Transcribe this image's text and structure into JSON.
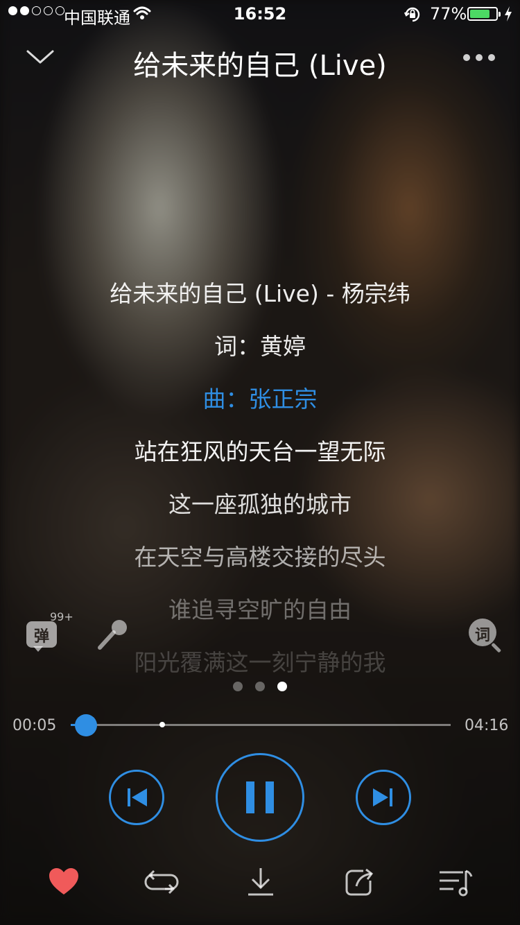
{
  "status_bar": {
    "carrier": "中国联通",
    "time": "16:52",
    "battery_percent": "77%",
    "battery_level": 0.77,
    "signal_bars": 2,
    "signal_total": 5
  },
  "header": {
    "title": "给未来的自己 (Live)",
    "collapse_icon": "chevron-down-icon",
    "more_icon": "more-dots-icon"
  },
  "lyrics": {
    "lines": [
      "给未来的自己 (Live) - 杨宗纬",
      "词：黄婷",
      "曲：张正宗",
      "站在狂风的天台一望无际",
      "这一座孤独的城市",
      "在天空与高楼交接的尽头",
      "谁追寻空旷的自由",
      "阳光覆满这一刻宁静的我"
    ],
    "active_index": 2
  },
  "side_actions": {
    "danmu_label": "弹",
    "danmu_count": "99+",
    "lyrics_search_label": "词"
  },
  "pager": {
    "pages": 3,
    "current": 2
  },
  "progress": {
    "current_time": "00:05",
    "total_time": "04:16",
    "played_fraction": 0.04,
    "buffered_fraction": 0.24
  },
  "colors": {
    "accent": "#2f8ee3",
    "favorite": "#f05a5a"
  },
  "controls": {
    "prev_icon": "skip-previous-icon",
    "play_pause_icon": "pause-icon",
    "next_icon": "skip-next-icon"
  },
  "bottom_bar": {
    "icons": [
      "heart-icon",
      "repeat-icon",
      "download-icon",
      "share-icon",
      "playlist-icon"
    ]
  }
}
